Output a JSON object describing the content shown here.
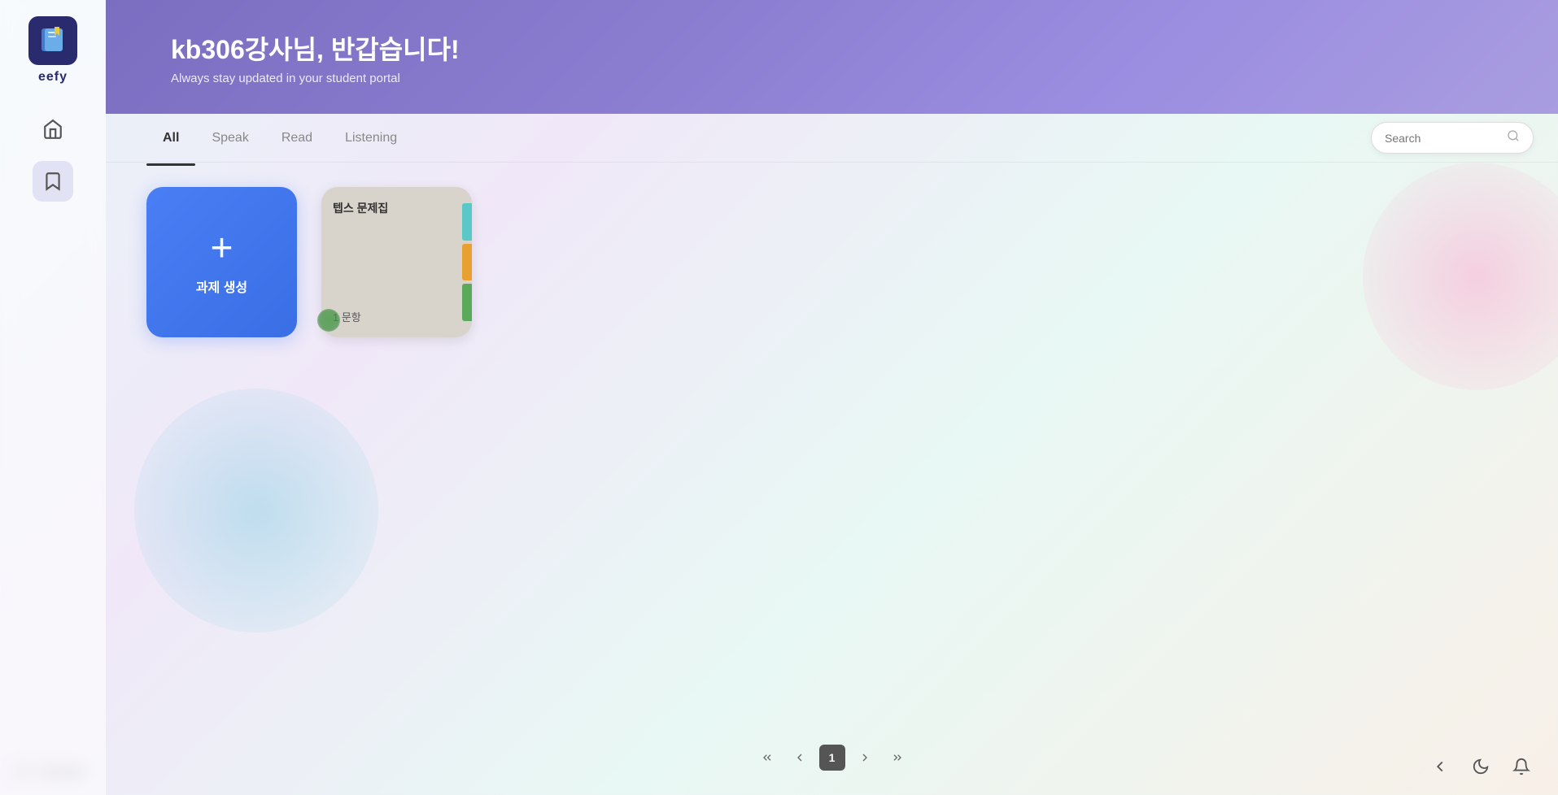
{
  "app": {
    "logo_text": "eefy"
  },
  "header": {
    "title": "kb306강사님, 반갑습니다!",
    "subtitle": "Always stay updated in your student portal"
  },
  "tabs": {
    "items": [
      {
        "label": "All",
        "active": true
      },
      {
        "label": "Speak",
        "active": false
      },
      {
        "label": "Read",
        "active": false
      },
      {
        "label": "Listening",
        "active": false
      }
    ]
  },
  "search": {
    "placeholder": "Search"
  },
  "create_card": {
    "plus": "+",
    "label": "과제 생성"
  },
  "book_card": {
    "title": "텝스 문제집",
    "count": "1 문항",
    "tabs_colors": [
      "#5bc8c8",
      "#e8a030",
      "#5baa5b"
    ]
  },
  "pagination": {
    "current_page": "1",
    "first_label": "«",
    "prev_label": "‹",
    "next_label": "›",
    "last_label": "»"
  },
  "nav": {
    "items": [
      {
        "name": "home",
        "icon": "home"
      },
      {
        "name": "bookmarks",
        "icon": "bookmark"
      }
    ]
  },
  "logout": {
    "label": "LOGOUT"
  }
}
